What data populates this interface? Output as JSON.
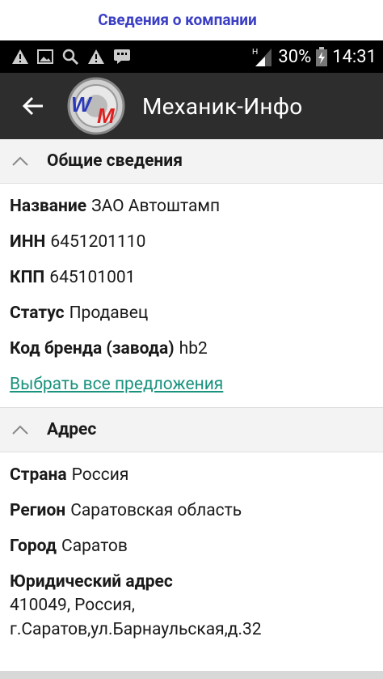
{
  "caption": "Сведения о компании",
  "status_bar": {
    "battery": "30%",
    "time": "14:31",
    "left_icons": [
      "warning-icon",
      "image-icon",
      "search-icon",
      "warning-icon",
      "message-icon"
    ],
    "right_icons": [
      "signal-icon",
      "battery-icon"
    ]
  },
  "app_bar": {
    "title": "Механик-Инфо"
  },
  "general": {
    "title": "Общие сведения",
    "name_label": "Название",
    "name_value": "ЗАО Автоштамп",
    "inn_label": "ИНН",
    "inn_value": "6451201110",
    "kpp_label": "КПП",
    "kpp_value": "645101001",
    "status_label": "Статус",
    "status_value": "Продавец",
    "brand_label": "Код бренда (завода)",
    "brand_value": "hb2",
    "link": "Выбрать все предложения"
  },
  "address": {
    "title": "Адрес",
    "country_label": "Страна",
    "country_value": "Россия",
    "region_label": "Регион",
    "region_value": "Саратовская область",
    "city_label": "Город",
    "city_value": "Саратов",
    "legal_label": "Юридический адрес",
    "legal_line1": "410049, Россия,",
    "legal_line2": "г.Саратов,ул.Барнаульская,д.32"
  },
  "colors": {
    "caption": "#3b3fc4",
    "appbar": "#2d2d2d",
    "link": "#19927e",
    "status_bar": "#000000"
  }
}
